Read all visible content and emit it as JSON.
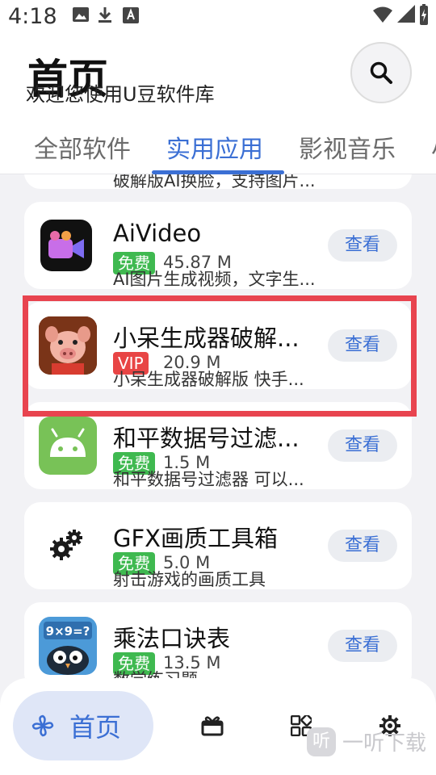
{
  "status_bar": {
    "time": "4:18"
  },
  "header": {
    "title": "首页",
    "subtitle": "欢迎您使用U豆软件库"
  },
  "tabs": [
    {
      "label": "全部软件"
    },
    {
      "label": "实用应用"
    },
    {
      "label": "影视音乐"
    },
    {
      "label": "小"
    }
  ],
  "active_tab": "实用应用",
  "apps": [
    {
      "name": "",
      "badge": "",
      "size": "",
      "desc": "破解版AI换脸，支持图片...",
      "button": ""
    },
    {
      "name": "AiVideo",
      "badge": "免费",
      "size": "45.87 M",
      "desc": "AI图片生成视频，文字生...",
      "button": "查看"
    },
    {
      "name": "小呆生成器破解...",
      "badge": "VIP",
      "size": "20.9 M",
      "desc": "小呆生成器破解版 快手...",
      "button": "查看"
    },
    {
      "name": "和平数据号过滤...",
      "badge": "免费",
      "size": "1.5 M",
      "desc": "和平数据号过滤器 可以...",
      "button": "查看"
    },
    {
      "name": "GFX画质工具箱",
      "badge": "免费",
      "size": "5.0 M",
      "desc": "射击游戏的画质工具",
      "button": "查看"
    },
    {
      "name": "乘法口诀表",
      "badge": "免费",
      "size": "13.5 M",
      "desc": "数学练习题",
      "button": "查看"
    }
  ],
  "app_icons": [
    "video-camera-icon",
    "pig-character-icon",
    "android-icon",
    "gears-icon",
    "multiplication-cartoon-icon"
  ],
  "multiplication_icon_text": "9×9=?",
  "bottom_nav": {
    "home_label": "首页",
    "items": [
      "home-pinwheel-icon",
      "gift-icon",
      "apps-grid-icon",
      "settings-gear-icon"
    ]
  },
  "watermark": {
    "logo": "听",
    "text": "一听下载"
  },
  "colors": {
    "accent": "#3b6fd4",
    "free_badge": "#3fb950",
    "vip_badge": "#e84545",
    "highlight": "#e8444f"
  }
}
